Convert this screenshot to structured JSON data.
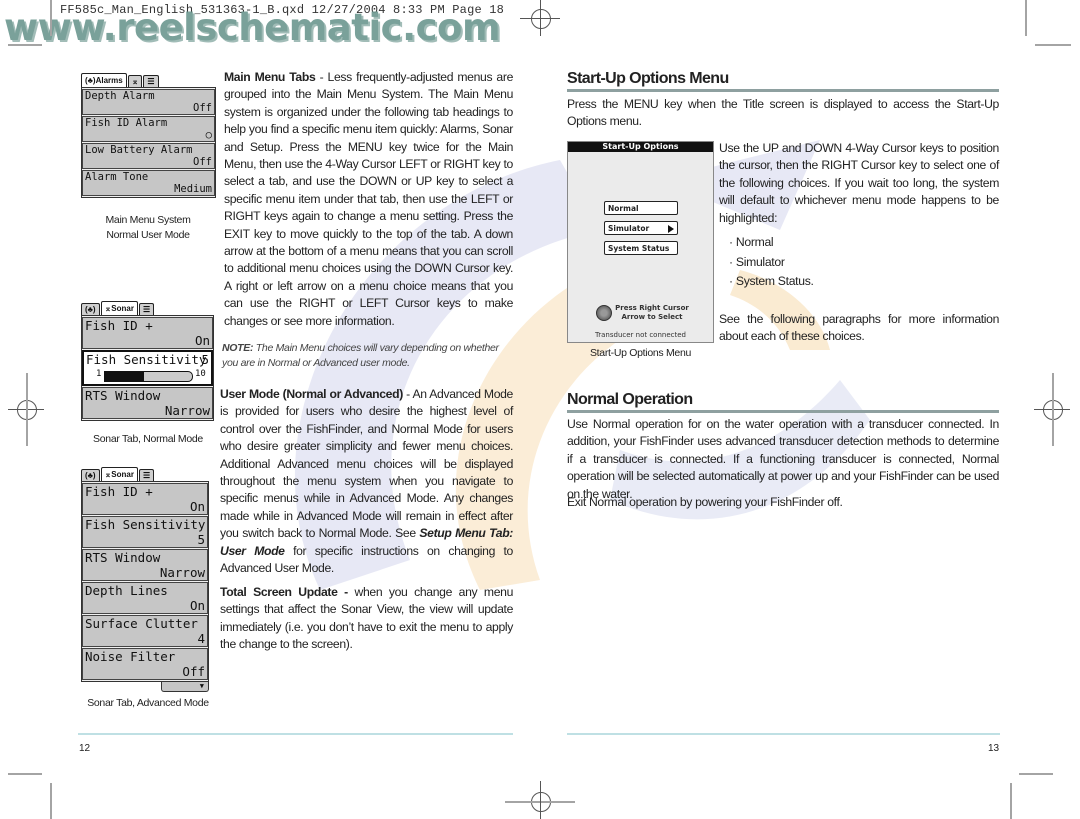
{
  "print_header": "FF585c_Man_English_531363-1_B.qxd  12/27/2004  8:33 PM  Page 18",
  "watermark": "www.reelschematic.com",
  "left_page": {
    "figures": [
      {
        "tabs": [
          "Alarms",
          "Sonar",
          "Setup"
        ],
        "active_tab": "Alarms",
        "items": [
          {
            "label": "Depth Alarm",
            "value": "Off"
          },
          {
            "label": "Fish ID Alarm",
            "value": "○"
          },
          {
            "label": "Low Battery Alarm",
            "value": "Off"
          },
          {
            "label": "Alarm Tone",
            "value": "Medium"
          }
        ],
        "caption_line1": "Main Menu System",
        "caption_line2": "Normal User Mode"
      },
      {
        "tabs": [
          "Alarms",
          "Sonar",
          "Setup"
        ],
        "active_tab": "Sonar",
        "items": [
          {
            "label": "Fish ID +",
            "value": "On"
          },
          {
            "label": "Fish Sensitivity",
            "value": "5",
            "slider_min": "1",
            "slider_max": "10",
            "slider_level": 5
          },
          {
            "label": "RTS Window",
            "value": "Narrow"
          }
        ],
        "caption": "Sonar Tab, Normal Mode"
      },
      {
        "tabs": [
          "Alarms",
          "Sonar",
          "Setup"
        ],
        "active_tab": "Sonar",
        "items": [
          {
            "label": "Fish ID +",
            "value": "On"
          },
          {
            "label": "Fish Sensitivity",
            "value": "5"
          },
          {
            "label": "RTS Window",
            "value": "Narrow"
          },
          {
            "label": "Depth Lines",
            "value": "On"
          },
          {
            "label": "Surface Clutter",
            "value": "4"
          },
          {
            "label": "Noise Filter",
            "value": "Off"
          }
        ],
        "caption": "Sonar Tab, Advanced Mode"
      }
    ],
    "main_menu_tabs": {
      "heading": "Main Menu Tabs",
      "text": " - Less frequently-adjusted menus are grouped into the Main Menu System. The Main Menu system is organized under the following tab headings to help you find a specific menu item quickly: Alarms, Sonar and Setup.  Press the MENU key twice for the Main Menu, then use the 4-Way Cursor LEFT or RIGHT key to select a tab, and use the DOWN or UP key to select a specific menu item under that tab, then use the LEFT or RIGHT keys again to change a menu setting. Press the EXIT key to move quickly to the top of the tab. A down arrow at the bottom of a menu means that you can scroll to additional menu choices using the DOWN Cursor key. A right or left arrow on a menu choice means that you can use the RIGHT or LEFT Cursor keys to make changes or see more information."
    },
    "note": {
      "label": "NOTE:",
      "text": " The Main Menu choices will vary depending on whether you are in Normal or Advanced user mode."
    },
    "user_mode": {
      "heading": "User Mode (Normal or Advanced)",
      "text1": " - An Advanced Mode is provided for users who desire the highest level of control over the FishFinder, and Normal Mode for users who desire greater simplicity and fewer menu choices. Additional Advanced menu choices will be displayed throughout the menu system when you navigate to specific menus while in Advanced Mode. Any changes made while in Advanced Mode will remain in effect after you switch back to Normal Mode. See ",
      "link": "Setup Menu Tab: User Mode",
      "text2": " for specific instructions on changing to Advanced User Mode."
    },
    "total_screen_update": {
      "heading": "Total Screen Update -",
      "text": " when you change any menu settings that affect the Sonar View, the view will update immediately (i.e. you don’t have to exit the menu to apply the change to the screen)."
    },
    "page_number": "12"
  },
  "right_page": {
    "startup_heading": "Start-Up Options Menu",
    "startup_intro": "Press the MENU key when the Title screen is displayed to access the Start-Up Options menu.",
    "startup_screen": {
      "title": "Start-Up Options",
      "options": [
        "Normal",
        "Simulator",
        "System Status"
      ],
      "hint_line1": "Press Right Cursor",
      "hint_line2": "Arrow to Select",
      "status": "Transducer not connected",
      "caption": "Start-Up Options Menu"
    },
    "startup_body": "Use the UP and DOWN 4-Way Cursor keys to position the cursor, then the RIGHT Cursor key to select one of the following choices. If you wait too long, the system will default to whichever menu mode happens to be highlighted:",
    "choices": [
      "Normal",
      "Simulator",
      "System Status."
    ],
    "see_following": "See the following paragraphs for more information about each of these choices.",
    "normal_heading": "Normal Operation",
    "normal_body": "Use Normal operation for on the water operation with a transducer connected. In addition, your FishFinder uses advanced transducer detection methods to determine if a transducer is connected. If a functioning transducer is connected, Normal operation will be selected automatically at power up and your FishFinder can be used on the water.",
    "normal_exit": "Exit Normal operation by powering your FishFinder off.",
    "page_number": "13"
  }
}
